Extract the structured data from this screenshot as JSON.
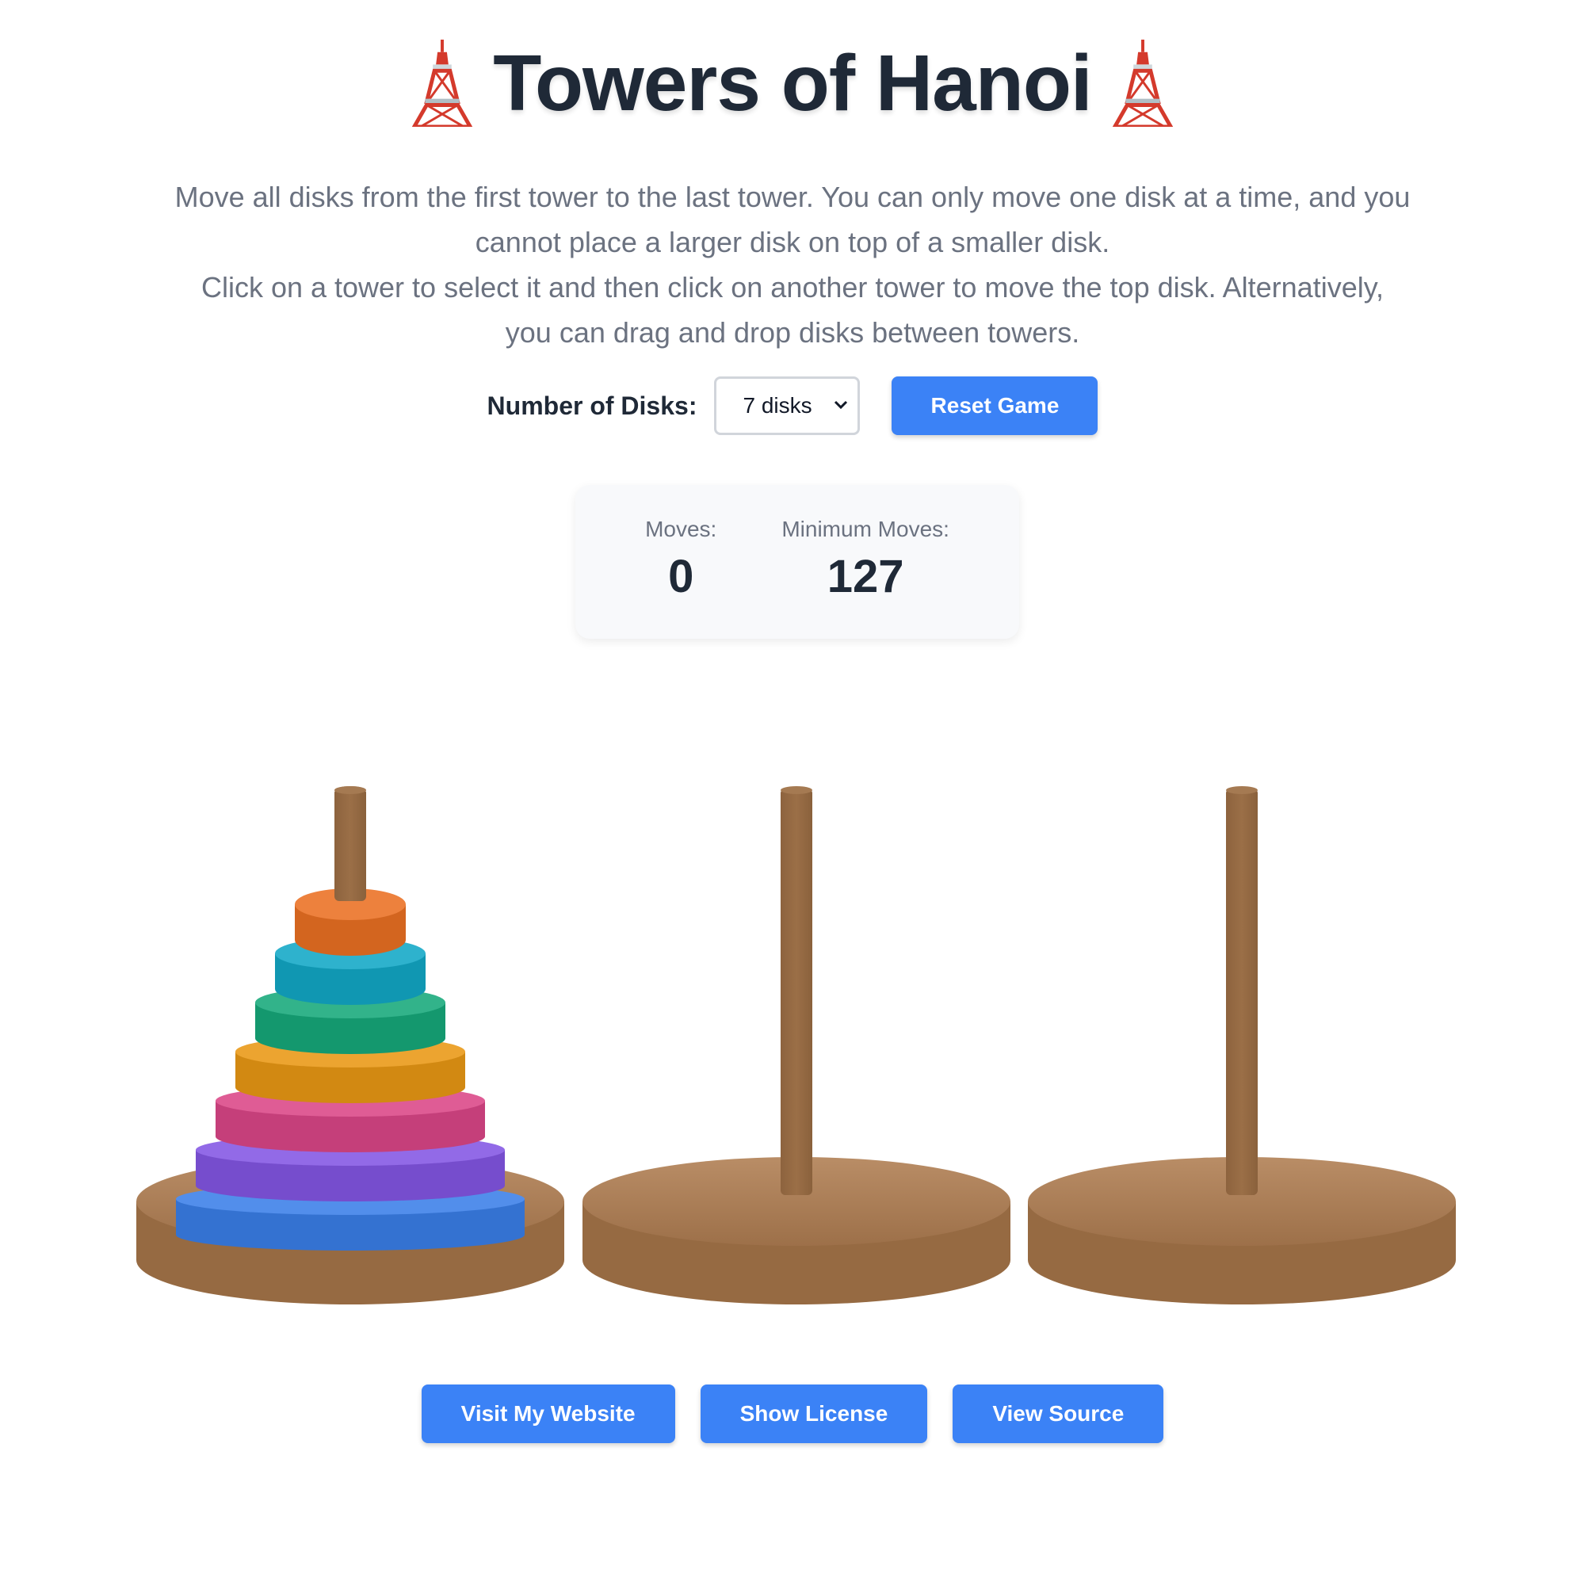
{
  "header": {
    "title": "Towers of Hanoi",
    "instructions": [
      "Move all disks from the first tower to the last tower. You can only move one disk at a time, and you cannot place a larger disk on top of a smaller disk.",
      "Click on a tower to select it and then click on another tower to move the top disk. Alternatively, you can drag and drop disks between towers."
    ]
  },
  "controls": {
    "disks_label": "Number of Disks:",
    "disks_selected": "7 disks",
    "reset_label": "Reset Game"
  },
  "stats": {
    "moves_label": "Moves:",
    "moves_value": "0",
    "min_moves_label": "Minimum Moves:",
    "min_moves_value": "127"
  },
  "game": {
    "towers": [
      {
        "disks": [
          7,
          6,
          5,
          4,
          3,
          2,
          1
        ]
      },
      {
        "disks": []
      },
      {
        "disks": []
      }
    ],
    "disk_colors": {
      "1": "#ea7022",
      "2": "#12a8c6",
      "3": "#16a97a",
      "4": "#e99814",
      "5": "#db4687",
      "6": "#8356e4",
      "7": "#3a7fe8"
    },
    "wood_color": "#966a42"
  },
  "footer": {
    "website_label": "Visit My Website",
    "license_label": "Show License",
    "source_label": "View Source"
  },
  "colors": {
    "accent": "#3b82f6",
    "title": "#1f2937",
    "muted": "#6b7280"
  }
}
